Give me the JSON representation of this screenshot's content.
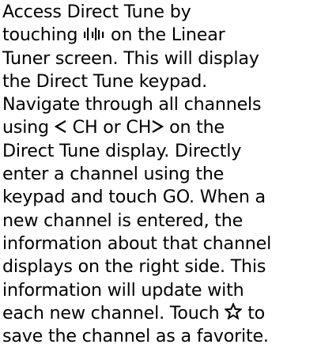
{
  "paragraph": {
    "l1": "Access Direct Tune by",
    "l2_a": "touching",
    "l2_b": "on the Linear",
    "l3": "Tuner screen. This will display",
    "l4": "the Direct Tune keypad.",
    "l5": "Navigate through all channels",
    "l6_a": "using",
    "l6_b": "CH or CH",
    "l6_c": "on the",
    "l7": "Direct Tune display. Directly",
    "l8": "enter a channel using the",
    "l9": "keypad and touch GO. When a",
    "l10": "new channel is entered, the",
    "l11": "information about that channel",
    "l12": "displays on the right side. This",
    "l13": "information will update with",
    "l14_a": "each new channel. Touch",
    "l14_b": "to",
    "l15": "save the channel as a favorite."
  },
  "icons": {
    "direct_tune": "direct-tune-bars-icon",
    "prev_channel": "chevron-left-icon",
    "next_channel": "chevron-right-icon",
    "favorite": "star-outline-icon"
  }
}
